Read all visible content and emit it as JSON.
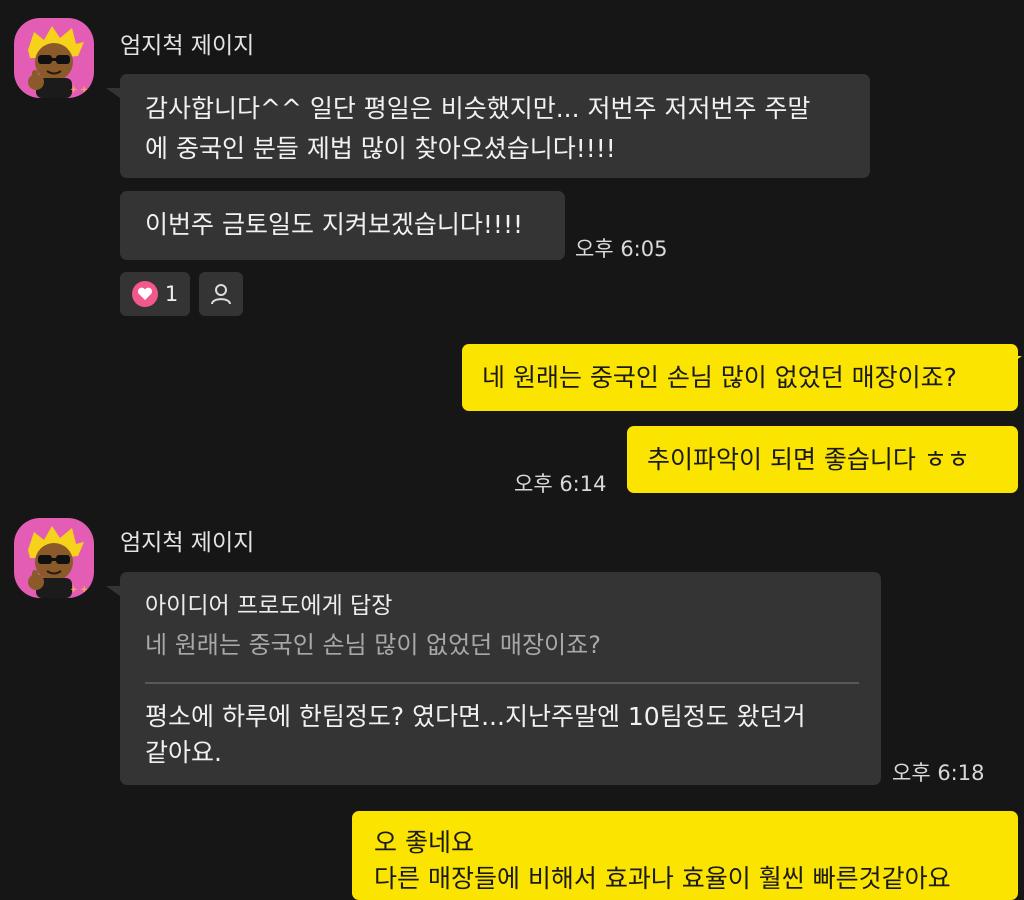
{
  "group1": {
    "sender_name": "엄지척 제이지",
    "messages": [
      "감사합니다^^ 일단 평일은 비슷했지만... 저번주 저저번주 주말\n에 중국인 분들 제법 많이 찾아오셨습니다!!!!",
      "이번주 금토일도 지켜보겠습니다!!!!"
    ],
    "time": "오후 6:05",
    "reaction": {
      "icon": "heart-icon",
      "count": "1",
      "add_icon": "person-icon"
    }
  },
  "my1": {
    "messages": [
      "네 원래는 중국인 손님 많이 없었던 매장이죠?",
      "추이파악이 되면 좋습니다 ㅎㅎ"
    ],
    "time": "오후 6:14"
  },
  "group2": {
    "sender_name": "엄지척 제이지",
    "reply": {
      "header": "아이디어 프로도에게 답장",
      "quoted": "네 원래는 중국인 손님 많이 없었던 매장이죠?",
      "text": "평소에 하루에 한팀정도? 였다면...지난주말엔 10팀정도 왔던거\n같아요."
    },
    "time": "오후 6:18"
  },
  "my2": {
    "message": "오 좋네요\n다른 매장들에 비해서 효과나 효율이 훨씬 빠른것같아요"
  },
  "colors": {
    "background": "#161616",
    "incoming_bubble": "#343434",
    "outgoing_bubble": "#fbe400",
    "avatar_bg": "#e45db4",
    "heart": "#f2588c"
  }
}
